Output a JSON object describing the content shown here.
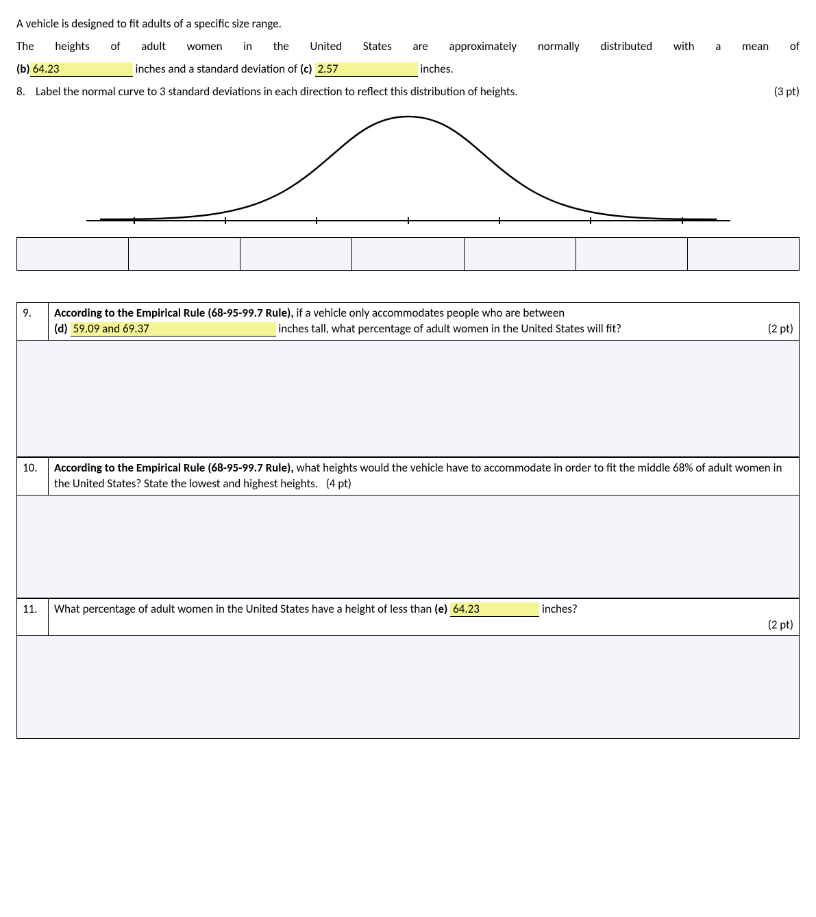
{
  "intro": {
    "line1": "A vehicle is designed to fit adults of a specific size range.",
    "line2_a": "The heights of adult women in the United States are approximately normally distributed with a mean of",
    "b_label": "(b)",
    "b_value": "64.23",
    "line2_mid": " inches and a standard deviation of ",
    "c_label": "(c)",
    "c_value": "2.57",
    "line2_end": " inches."
  },
  "q8": {
    "num": "8.",
    "text": "Label the normal curve to 3 standard deviations in each direction to reflect this distribution of heights.",
    "pts": "(3 pt)"
  },
  "q9": {
    "num": "9.",
    "lead": "According to the Empirical Rule (68-95-99.7 Rule),",
    "rest1": " if a vehicle only accommodates people who are between",
    "d_label": "(d)",
    "d_value": "59.09 and 69.37",
    "rest2": " inches tall, what percentage of adult women in the United States will fit?",
    "pts": "(2 pt)"
  },
  "q10": {
    "num": "10.",
    "lead": "According to the Empirical Rule (68-95-99.7 Rule),",
    "rest": " what heights would the vehicle have to accommodate in order to fit the middle 68% of adult women in the United States? State the lowest and highest heights.",
    "pts": "(4 pt)"
  },
  "q11": {
    "num": "11.",
    "text1": "What percentage of adult women in the United States have a height of less than ",
    "e_label": "(e)",
    "e_value": "64.23",
    "text2": " inches?",
    "pts": "(2 pt)"
  },
  "chart_data": {
    "type": "line",
    "title": "Normal distribution curve (unlabeled axis, 7 tick marks for ±3 SD)",
    "x": [
      -3,
      -2,
      -1,
      0,
      1,
      2,
      3
    ],
    "values": [
      0.0044,
      0.054,
      0.242,
      0.399,
      0.242,
      0.054,
      0.0044
    ],
    "xlabel": "",
    "ylabel": "",
    "ticks": 7
  }
}
